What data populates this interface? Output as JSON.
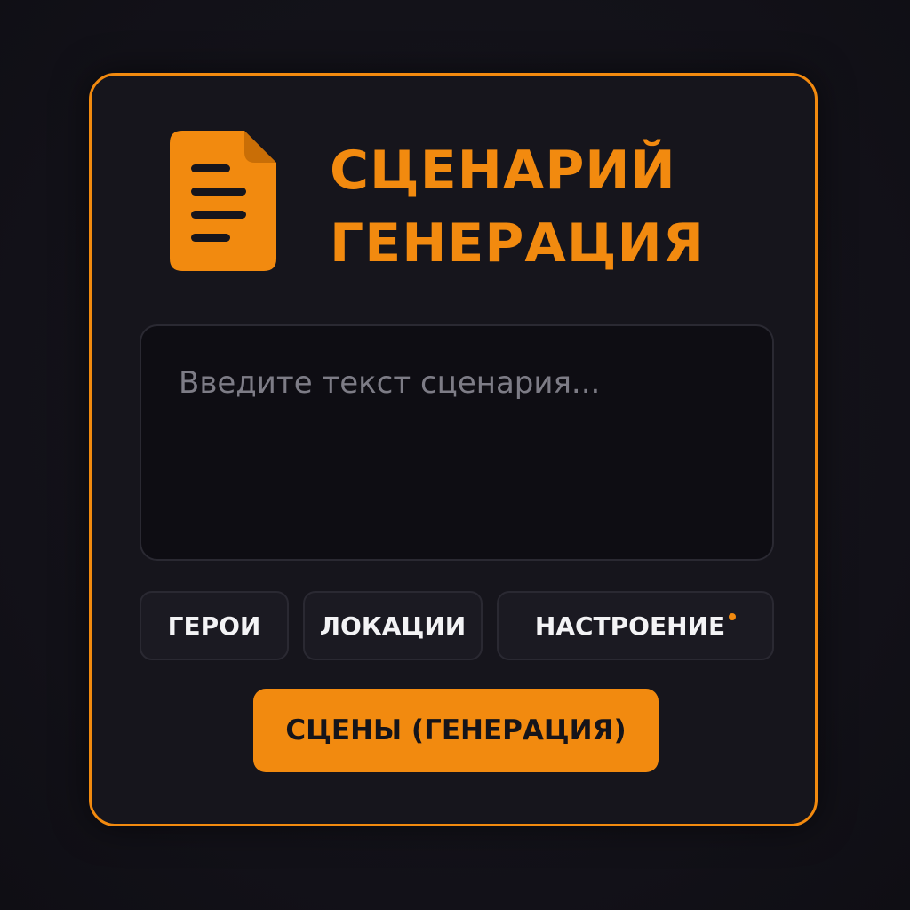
{
  "header": {
    "icon": "document-icon",
    "title_line1": "СЦЕНАРИЙ",
    "title_line2": "ГЕНЕРАЦИЯ"
  },
  "editor": {
    "value": "",
    "placeholder": "Введите текст сценария..."
  },
  "tags": [
    {
      "label": "ГЕРОИ"
    },
    {
      "label": "ЛОКАЦИИ"
    },
    {
      "label": "НАСТРОЕНИЕ",
      "indicator": "dot"
    }
  ],
  "action": {
    "label": "СЦЕНЫ (ГЕНЕРАЦИЯ)"
  },
  "colors": {
    "accent": "#f28a0f",
    "background": "#131219",
    "card": "#16151c",
    "text": "#f3f3f5",
    "placeholder": "#7d7c86"
  }
}
